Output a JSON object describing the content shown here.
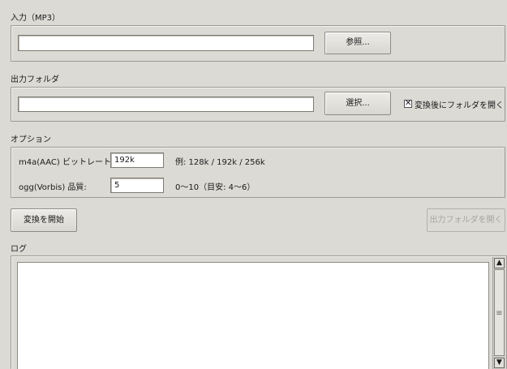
{
  "input": {
    "section_label": "入力（MP3）",
    "file_value": "",
    "browse_label": "参照..."
  },
  "output": {
    "section_label": "出力フォルダ",
    "folder_value": "",
    "select_label": "選択...",
    "open_after_label": "変換後にフォルダを開く",
    "open_after_checked": true,
    "check_mark": "✕"
  },
  "options": {
    "section_label": "オプション",
    "m4a_label": "m4a(AAC) ビットレート:",
    "m4a_value": "192k",
    "m4a_hint": "例: 128k / 192k / 256k",
    "ogg_label": "ogg(Vorbis) 品質:",
    "ogg_value": "5",
    "ogg_hint": "0〜10（目安: 4〜6）"
  },
  "actions": {
    "start_label": "変換を開始",
    "open_output_label": "出力フォルダを開く"
  },
  "log": {
    "section_label": "ログ",
    "content": "",
    "scroll_up_glyph": "▲",
    "scroll_down_glyph": "▼",
    "grip_glyph": "≡"
  }
}
